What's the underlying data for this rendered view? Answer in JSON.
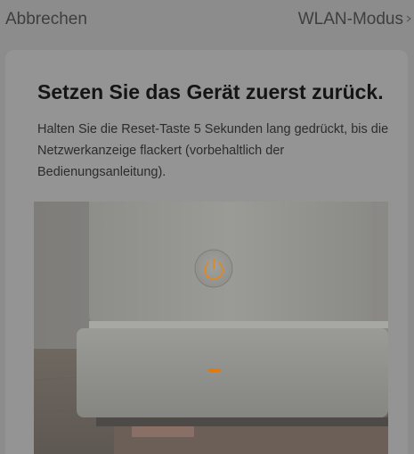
{
  "nav": {
    "cancel_label": "Abbrechen",
    "mode_label": "WLAN-Modus",
    "mode_icon": "chevron-right-icon"
  },
  "instruction": {
    "title": "Setzen Sie das Gerät zuerst zurück.",
    "description": "Halten Sie die Reset-Taste 5 Sekunden lang gedrückt, bis die Netzwerkanzeige flackert (vorbehaltlich der Bedienungsanleitung)."
  },
  "image": {
    "subject": "router-device-photo",
    "power_icon": "power-icon",
    "indicator_color": "#e07a10"
  },
  "colors": {
    "overlay": "#8c8c8c",
    "card": "#949494",
    "title_text": "#151515",
    "body_text": "#2c2c2c",
    "accent": "#e07a10"
  }
}
